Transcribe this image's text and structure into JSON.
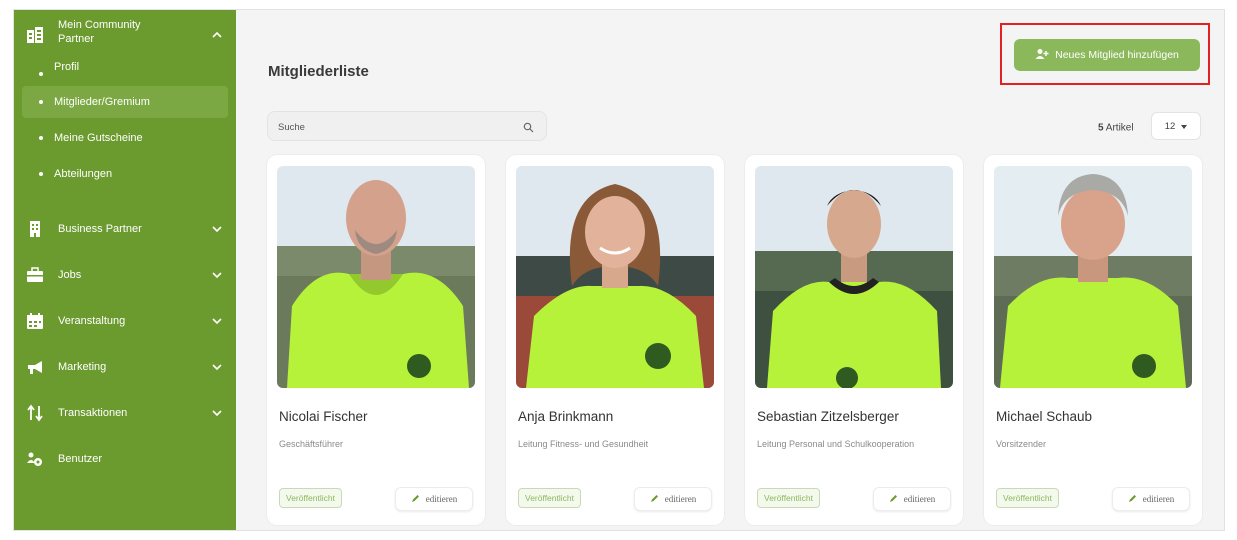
{
  "sidebar": {
    "community": {
      "label": "Mein Community Partner",
      "icon": "buildings-icon",
      "items": [
        "Profil",
        "Mitglieder/Gremium",
        "Meine Gutscheine",
        "Abteilungen"
      ],
      "active_index": 1
    },
    "items": [
      {
        "label": "Business Partner",
        "icon": "building-icon"
      },
      {
        "label": "Jobs",
        "icon": "briefcase-icon"
      },
      {
        "label": "Veranstaltung",
        "icon": "calendar-icon"
      },
      {
        "label": "Marketing",
        "icon": "megaphone-icon"
      },
      {
        "label": "Transaktionen",
        "icon": "arrows-up-down-icon"
      },
      {
        "label": "Benutzer",
        "icon": "users-gear-icon"
      }
    ]
  },
  "header": {
    "title": "Mitgliederliste",
    "add_button": "Neues Mitglied hinzufügen"
  },
  "search": {
    "placeholder": "Suche"
  },
  "pagination": {
    "count": "5",
    "count_label": "Artikel",
    "per_page": "12"
  },
  "members": [
    {
      "name": "Nicolai Fischer",
      "role": "Geschäftsführer",
      "status": "Veröffentlicht",
      "edit": "editieren"
    },
    {
      "name": "Anja Brinkmann",
      "role": "Leitung Fitness- und Gesundheit",
      "status": "Veröffentlicht",
      "edit": "editieren"
    },
    {
      "name": "Sebastian Zitzelsberger",
      "role": "Leitung Personal und Schulkooperation",
      "status": "Veröffentlicht",
      "edit": "editieren"
    },
    {
      "name": "Michael Schaub",
      "role": "Vorsitzender",
      "status": "Veröffentlicht",
      "edit": "editieren"
    }
  ],
  "colors": {
    "sidebar": "#6b9a2e",
    "accent": "#8cb85c",
    "highlight_border": "#e02222",
    "hoodie": "#b6f23a"
  }
}
